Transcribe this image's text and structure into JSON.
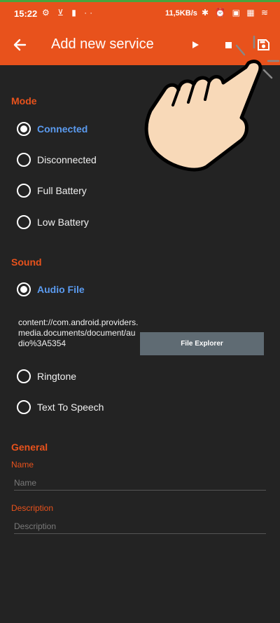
{
  "status_bar": {
    "time": "15:22",
    "left_icons": "⚙ ⊻ ▮ ··",
    "net_speed": "11,5KB/s",
    "right_icons": "✱ ⏰ ▣ ▦ ≋"
  },
  "app_bar": {
    "title": "Add new service",
    "back_icon": "arrow-left-icon",
    "play_icon": "play-icon",
    "stop_icon": "stop-icon",
    "save_icon": "save-icon"
  },
  "mode": {
    "header": "Mode",
    "options": [
      {
        "label": "Connected",
        "checked": true
      },
      {
        "label": "Disconnected",
        "checked": false
      },
      {
        "label": "Full Battery",
        "checked": false
      },
      {
        "label": "Low Battery",
        "checked": false
      }
    ]
  },
  "sound": {
    "header": "Sound",
    "options": [
      {
        "label": "Audio File",
        "checked": true
      },
      {
        "label": "Ringtone",
        "checked": false
      },
      {
        "label": "Text To Speech",
        "checked": false
      }
    ],
    "file_path": "content://com.android.providers.media.documents/document/audio%3A5354",
    "file_explorer_label": "File Explorer"
  },
  "general": {
    "header": "General",
    "name_label": "Name",
    "name_placeholder": "Name",
    "name_value": "",
    "description_label": "Description",
    "description_placeholder": "Description",
    "description_value": ""
  },
  "colors": {
    "accent": "#e8521c",
    "selected_text": "#5b9bf0",
    "background": "#232323",
    "button": "#5f6b73"
  }
}
